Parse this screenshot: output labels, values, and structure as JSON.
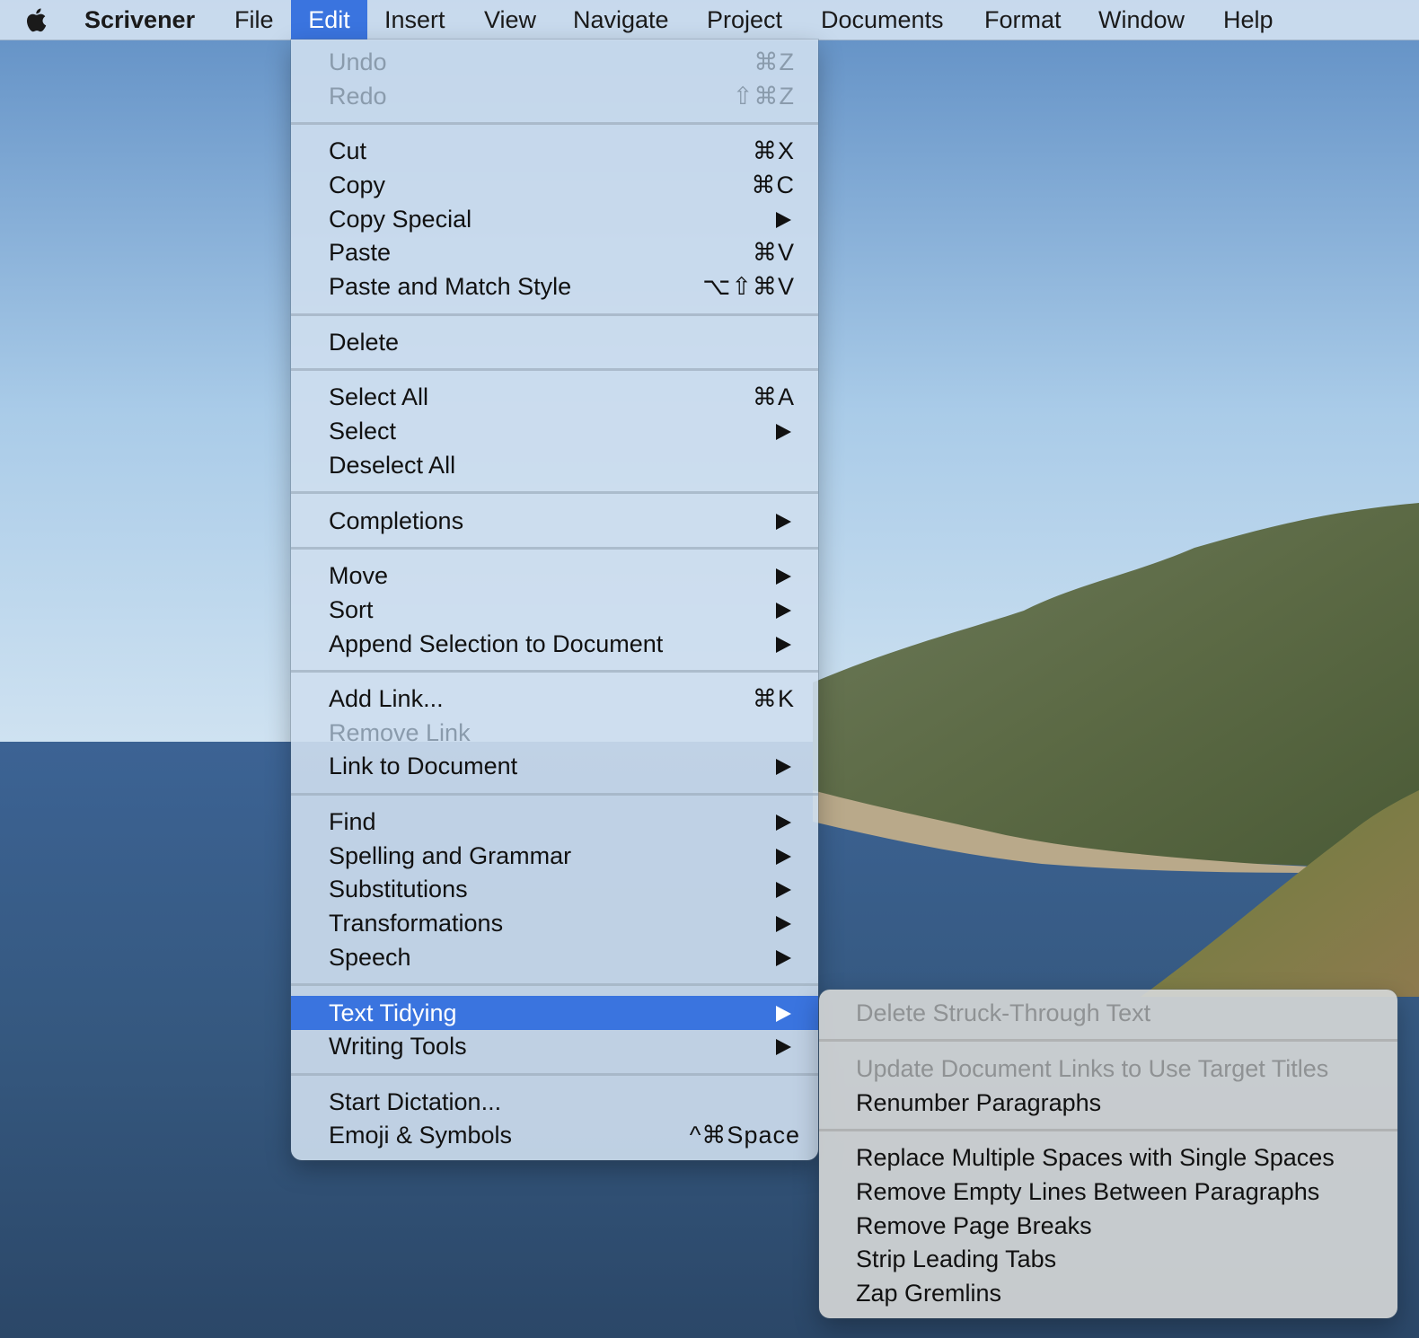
{
  "menubar": {
    "apple_icon": "apple-logo-icon",
    "app_name": "Scrivener",
    "items": [
      "File",
      "Edit",
      "Insert",
      "View",
      "Navigate",
      "Project",
      "Documents",
      "Format",
      "Window",
      "Help"
    ],
    "active_item": "Edit"
  },
  "edit_menu": {
    "items": [
      {
        "label": "Undo",
        "shortcut": "⌘Z",
        "enabled": false
      },
      {
        "label": "Redo",
        "shortcut": "⇧⌘Z",
        "enabled": false
      },
      {
        "label": "Cut",
        "shortcut": "⌘X",
        "enabled": true
      },
      {
        "label": "Copy",
        "shortcut": "⌘C",
        "enabled": true
      },
      {
        "label": "Copy Special",
        "submenu": true,
        "enabled": true
      },
      {
        "label": "Paste",
        "shortcut": "⌘V",
        "enabled": true
      },
      {
        "label": "Paste and Match Style",
        "shortcut": "⌥⇧⌘V",
        "enabled": true
      },
      {
        "label": "Delete",
        "enabled": true
      },
      {
        "label": "Select All",
        "shortcut": "⌘A",
        "enabled": true
      },
      {
        "label": "Select",
        "submenu": true,
        "enabled": true
      },
      {
        "label": "Deselect All",
        "enabled": true
      },
      {
        "label": "Completions",
        "submenu": true,
        "enabled": true
      },
      {
        "label": "Move",
        "submenu": true,
        "enabled": true
      },
      {
        "label": "Sort",
        "submenu": true,
        "enabled": true
      },
      {
        "label": "Append Selection to Document",
        "submenu": true,
        "enabled": true
      },
      {
        "label": "Add Link...",
        "shortcut": "⌘K",
        "enabled": true
      },
      {
        "label": "Remove Link",
        "enabled": false
      },
      {
        "label": "Link to Document",
        "submenu": true,
        "enabled": true
      },
      {
        "label": "Find",
        "submenu": true,
        "enabled": true
      },
      {
        "label": "Spelling and Grammar",
        "submenu": true,
        "enabled": true
      },
      {
        "label": "Substitutions",
        "submenu": true,
        "enabled": true
      },
      {
        "label": "Transformations",
        "submenu": true,
        "enabled": true
      },
      {
        "label": "Speech",
        "submenu": true,
        "enabled": true
      },
      {
        "label": "Text Tidying",
        "submenu": true,
        "enabled": true,
        "highlighted": true
      },
      {
        "label": "Writing Tools",
        "submenu": true,
        "enabled": true
      },
      {
        "label": "Start Dictation...",
        "enabled": true
      },
      {
        "label": "Emoji & Symbols",
        "shortcut": "^⌘Space",
        "enabled": true
      }
    ]
  },
  "text_tidying_submenu": {
    "items": [
      {
        "label": "Delete Struck-Through Text",
        "enabled": false
      },
      {
        "label": "Update Document Links to Use Target Titles",
        "enabled": false
      },
      {
        "label": "Renumber Paragraphs",
        "enabled": true
      },
      {
        "label": "Replace Multiple Spaces with Single Spaces",
        "enabled": true
      },
      {
        "label": "Remove Empty Lines Between Paragraphs",
        "enabled": true
      },
      {
        "label": "Remove Page Breaks",
        "enabled": true
      },
      {
        "label": "Strip Leading Tabs",
        "enabled": true
      },
      {
        "label": "Zap Gremlins",
        "enabled": true
      }
    ]
  },
  "colors": {
    "highlight": "#3a74df",
    "disabled_text": "#8a9bac",
    "menu_background": "#cedeee"
  }
}
